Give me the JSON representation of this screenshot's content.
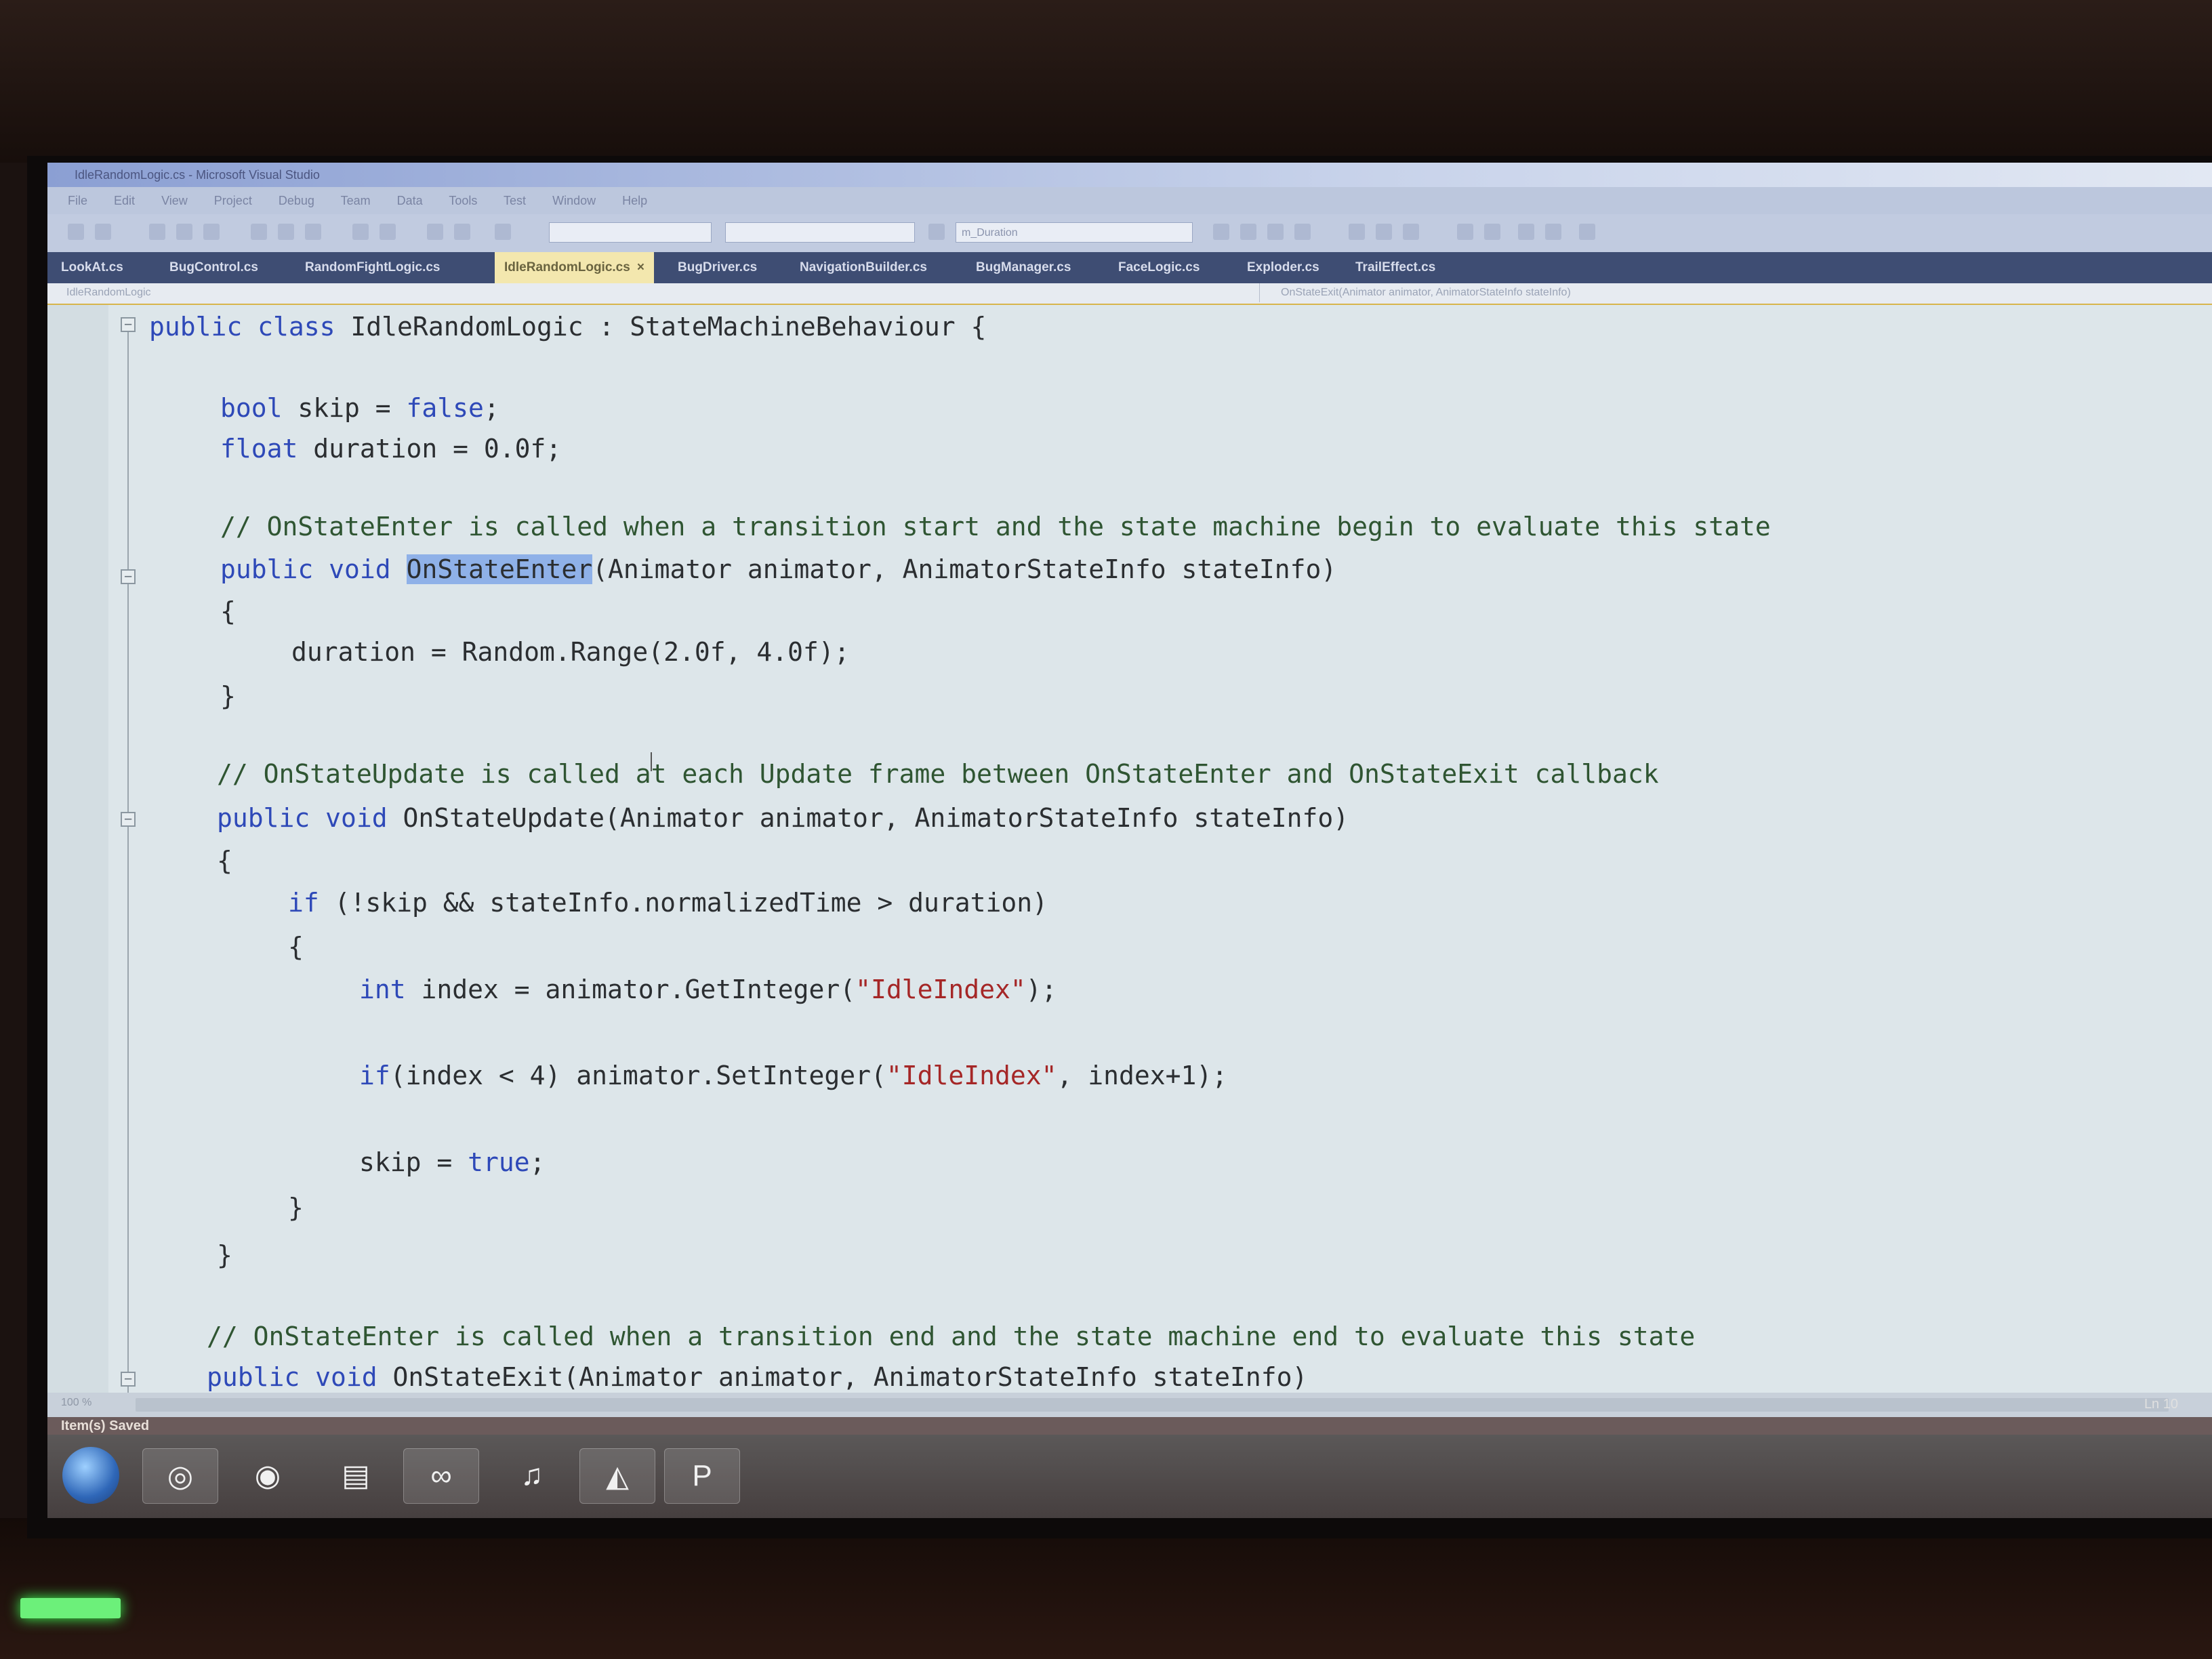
{
  "window": {
    "title": "IdleRandomLogic.cs - Microsoft Visual Studio",
    "menu": [
      "File",
      "Edit",
      "View",
      "Project",
      "Debug",
      "Team",
      "Data",
      "Tools",
      "Test",
      "Window",
      "Help"
    ],
    "toolbar_combo": "m_Duration"
  },
  "tabs": [
    {
      "label": "LookAt.cs",
      "active": false
    },
    {
      "label": "BugControl.cs",
      "active": false
    },
    {
      "label": "RandomFightLogic.cs",
      "active": false
    },
    {
      "label": "IdleRandomLogic.cs",
      "active": true
    },
    {
      "label": "BugDriver.cs",
      "active": false
    },
    {
      "label": "NavigationBuilder.cs",
      "active": false
    },
    {
      "label": "BugManager.cs",
      "active": false
    },
    {
      "label": "FaceLogic.cs",
      "active": false
    },
    {
      "label": "Exploder.cs",
      "active": false
    },
    {
      "label": "TrailEffect.cs",
      "active": false
    }
  ],
  "navigation": {
    "type_dropdown": "IdleRandomLogic",
    "member_dropdown": "OnStateExit(Animator animator, AnimatorStateInfo stateInfo)"
  },
  "code": {
    "l1_kw": "public class",
    "l1_rest": " IdleRandomLogic : StateMachineBehaviour {",
    "l2_kw": "bool",
    "l2_rest": " skip = ",
    "l2_val": "false",
    "l2_end": ";",
    "l3_kw": "float",
    "l3_rest": " duration = 0.0f;",
    "c1": "// OnStateEnter is called when a transition start and the state machine begin to evaluate this state",
    "l4_kw": "public void",
    "l4_sel": "OnStateEnter",
    "l4_rest": "(Animator animator, AnimatorStateInfo stateInfo)",
    "l5": "{",
    "l6": "duration = Random.Range(2.0f, 4.0f);",
    "l7": "}",
    "c2": "// OnStateUpdate is called at each Update frame between OnStateEnter and OnStateExit callback",
    "l8_kw": "public void",
    "l8_rest": " OnStateUpdate(Animator animator, AnimatorStateInfo stateInfo)",
    "l9": "{",
    "l10_kw": "if",
    "l10_rest": " (!skip && stateInfo.normalizedTime > duration)",
    "l11": "{",
    "l12_kw": "int",
    "l12_rest": " index = animator.GetInteger(",
    "l12_str": "\"IdleIndex\"",
    "l12_end": ");",
    "l13_kw": "if",
    "l13_rest": "(index < 4) animator.SetInteger(",
    "l13_str": "\"IdleIndex\"",
    "l13_end": ", index+1);",
    "l14_rest": "skip = ",
    "l14_val": "true",
    "l14_end": ";",
    "l15": "}",
    "l16": "}",
    "c3": "// OnStateEnter is called when a transition end and the state machine end to evaluate this state",
    "l17_kw": "public void",
    "l17_rest": " OnStateExit(Animator animator, AnimatorStateInfo stateInfo)"
  },
  "editor_status": {
    "zoom": "100 %",
    "line": "Ln 10"
  },
  "statusbar": {
    "message": "Item(s) Saved"
  },
  "taskbar": {
    "items": [
      "start-orb-icon",
      "ie-icon",
      "chrome-icon",
      "folder-icon",
      "visual-studio-icon",
      "itunes-icon",
      "unity-icon",
      "powerpoint-icon"
    ]
  },
  "colors": {
    "keyword": "#2e49b8",
    "comment": "#2f5532",
    "string": "#a52727",
    "selection": "#8fb1e8",
    "editor_bg": "#dde6ea"
  }
}
